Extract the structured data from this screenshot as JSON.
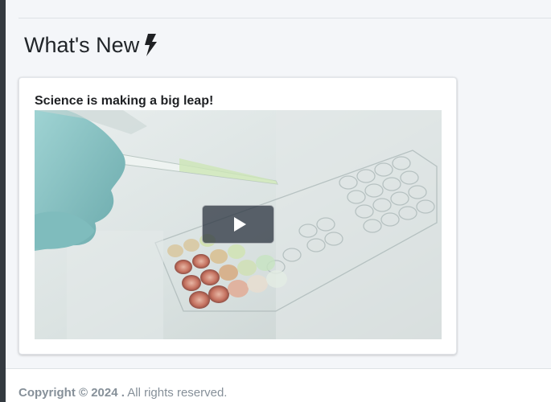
{
  "page": {
    "title": "What's New"
  },
  "news_card": {
    "heading": "Science is making a big leap!",
    "video": {
      "play_label": "Play Video"
    }
  },
  "footer": {
    "copyright": "Copyright © 2024 .",
    "rights": " All rights reserved."
  },
  "colors": {
    "sidebar": "#343a40",
    "background": "#f4f6f9",
    "card": "#ffffff",
    "footer_text": "#869099"
  }
}
